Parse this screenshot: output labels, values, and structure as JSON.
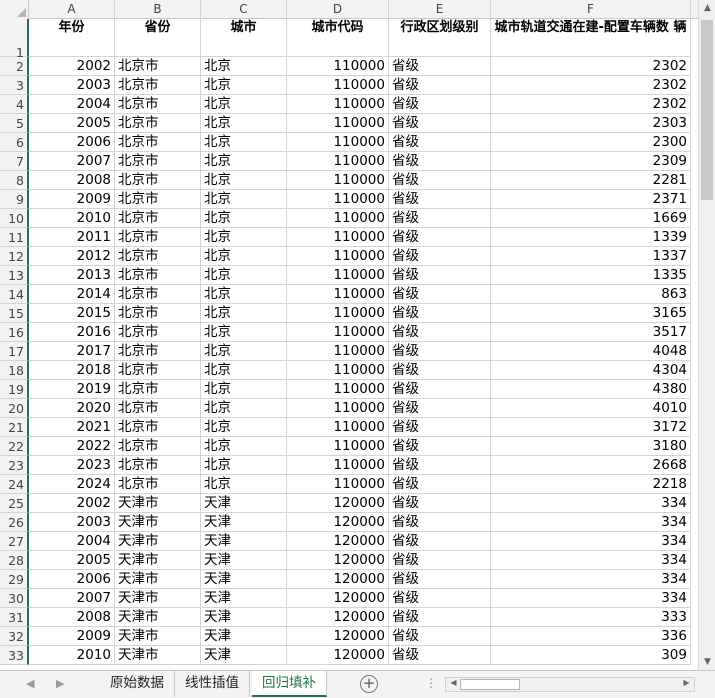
{
  "columns": [
    "A",
    "B",
    "C",
    "D",
    "E",
    "F"
  ],
  "headers": [
    "年份",
    "省份",
    "城市",
    "城市代码",
    "行政区划级别",
    "城市轨道交通在建-配置车辆数 辆"
  ],
  "rows": [
    [
      "2002",
      "北京市",
      "北京",
      "110000",
      "省级",
      "2302"
    ],
    [
      "2003",
      "北京市",
      "北京",
      "110000",
      "省级",
      "2302"
    ],
    [
      "2004",
      "北京市",
      "北京",
      "110000",
      "省级",
      "2302"
    ],
    [
      "2005",
      "北京市",
      "北京",
      "110000",
      "省级",
      "2303"
    ],
    [
      "2006",
      "北京市",
      "北京",
      "110000",
      "省级",
      "2300"
    ],
    [
      "2007",
      "北京市",
      "北京",
      "110000",
      "省级",
      "2309"
    ],
    [
      "2008",
      "北京市",
      "北京",
      "110000",
      "省级",
      "2281"
    ],
    [
      "2009",
      "北京市",
      "北京",
      "110000",
      "省级",
      "2371"
    ],
    [
      "2010",
      "北京市",
      "北京",
      "110000",
      "省级",
      "1669"
    ],
    [
      "2011",
      "北京市",
      "北京",
      "110000",
      "省级",
      "1339"
    ],
    [
      "2012",
      "北京市",
      "北京",
      "110000",
      "省级",
      "1337"
    ],
    [
      "2013",
      "北京市",
      "北京",
      "110000",
      "省级",
      "1335"
    ],
    [
      "2014",
      "北京市",
      "北京",
      "110000",
      "省级",
      "863"
    ],
    [
      "2015",
      "北京市",
      "北京",
      "110000",
      "省级",
      "3165"
    ],
    [
      "2016",
      "北京市",
      "北京",
      "110000",
      "省级",
      "3517"
    ],
    [
      "2017",
      "北京市",
      "北京",
      "110000",
      "省级",
      "4048"
    ],
    [
      "2018",
      "北京市",
      "北京",
      "110000",
      "省级",
      "4304"
    ],
    [
      "2019",
      "北京市",
      "北京",
      "110000",
      "省级",
      "4380"
    ],
    [
      "2020",
      "北京市",
      "北京",
      "110000",
      "省级",
      "4010"
    ],
    [
      "2021",
      "北京市",
      "北京",
      "110000",
      "省级",
      "3172"
    ],
    [
      "2022",
      "北京市",
      "北京",
      "110000",
      "省级",
      "3180"
    ],
    [
      "2023",
      "北京市",
      "北京",
      "110000",
      "省级",
      "2668"
    ],
    [
      "2024",
      "北京市",
      "北京",
      "110000",
      "省级",
      "2218"
    ],
    [
      "2002",
      "天津市",
      "天津",
      "120000",
      "省级",
      "334"
    ],
    [
      "2003",
      "天津市",
      "天津",
      "120000",
      "省级",
      "334"
    ],
    [
      "2004",
      "天津市",
      "天津",
      "120000",
      "省级",
      "334"
    ],
    [
      "2005",
      "天津市",
      "天津",
      "120000",
      "省级",
      "334"
    ],
    [
      "2006",
      "天津市",
      "天津",
      "120000",
      "省级",
      "334"
    ],
    [
      "2007",
      "天津市",
      "天津",
      "120000",
      "省级",
      "334"
    ],
    [
      "2008",
      "天津市",
      "天津",
      "120000",
      "省级",
      "333"
    ],
    [
      "2009",
      "天津市",
      "天津",
      "120000",
      "省级",
      "336"
    ],
    [
      "2010",
      "天津市",
      "天津",
      "120000",
      "省级",
      "309"
    ]
  ],
  "tabs": [
    {
      "label": "原始数据",
      "active": false
    },
    {
      "label": "线性插值",
      "active": false
    },
    {
      "label": "回归填补",
      "active": true
    }
  ],
  "colors": {
    "accent": "#217346",
    "grid": "#d4d4d4",
    "header_bg": "#f3f3f3"
  }
}
